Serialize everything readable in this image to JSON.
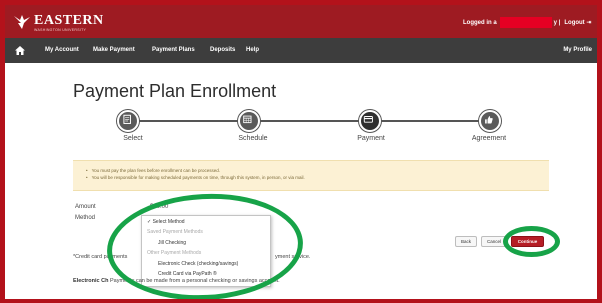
{
  "header": {
    "brand": "EASTERN",
    "brand_sub": "WASHINGTON UNIVERSITY",
    "logged_in_label": "Logged in a",
    "logged_in_suffix": "y |",
    "logout": "Logout ⇥"
  },
  "nav": {
    "items": [
      "My Account",
      "Make Payment",
      "Payment Plans",
      "Deposits",
      "Help"
    ],
    "profile": "My Profile"
  },
  "page": {
    "title": "Payment Plan Enrollment"
  },
  "steps": [
    {
      "label": "Select",
      "icon": "document-icon",
      "state": "done"
    },
    {
      "label": "Schedule",
      "icon": "calendar-icon",
      "state": "done"
    },
    {
      "label": "Payment",
      "icon": "card-icon",
      "state": "current"
    },
    {
      "label": "Agreement",
      "icon": "thumbs-up-icon",
      "state": "todo"
    }
  ],
  "notice": [
    "You must pay the plan fees before enrollment can be processed.",
    "You will be responsible for making scheduled payments on time, through this system, in person, or via mail."
  ],
  "form": {
    "amount_label": "Amount",
    "amount_value": "$40.00",
    "method_label": "Method",
    "method_options": [
      {
        "text": "✓ Select Method",
        "kind": "selected"
      },
      {
        "text": "Saved Payment Methods",
        "kind": "header"
      },
      {
        "text": "Jill Checking",
        "kind": "option"
      },
      {
        "text": "Other Payment Methods",
        "kind": "header"
      },
      {
        "text": "Electronic Check (checking/savings)",
        "kind": "option"
      },
      {
        "text": "Credit Card via PayPath ®",
        "kind": "option"
      }
    ]
  },
  "notes": {
    "credit_left": "*Credit card payments",
    "credit_right": "yment service.",
    "echeck_bold": "Electronic Ch",
    "echeck_rest": "Payments can be made from a personal checking or savings account."
  },
  "buttons": {
    "back": "Back",
    "cancel": "Cancel",
    "continue": "Continue"
  },
  "colors": {
    "brand_red": "#9e1b22",
    "nav_dark": "#3d3d3d",
    "annotation_green": "#17a348",
    "frame_red": "#b3121b"
  }
}
